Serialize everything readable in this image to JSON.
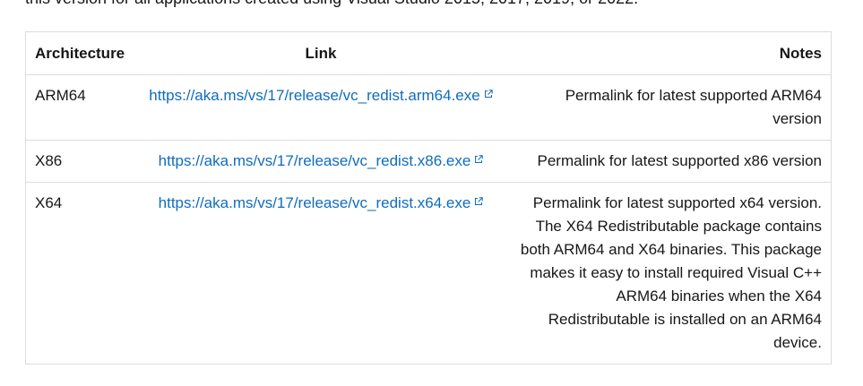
{
  "intro_text": "this version for all applications created using Visual Studio 2015, 2017, 2019, or 2022.",
  "table": {
    "headers": {
      "architecture": "Architecture",
      "link": "Link",
      "notes": "Notes"
    },
    "rows": [
      {
        "architecture": "ARM64",
        "link": "https://aka.ms/vs/17/release/vc_redist.arm64.exe",
        "notes": "Permalink for latest supported ARM64 version"
      },
      {
        "architecture": "X86",
        "link": "https://aka.ms/vs/17/release/vc_redist.x86.exe",
        "notes": "Permalink for latest supported x86 version"
      },
      {
        "architecture": "X64",
        "link": "https://aka.ms/vs/17/release/vc_redist.x64.exe",
        "notes": "Permalink for latest supported x64 version. The X64 Redistributable package contains both ARM64 and X64 binaries. This package makes it easy to install required Visual C++ ARM64 binaries when the X64 Redistributable is installed on an ARM64 device."
      }
    ]
  },
  "icons": {
    "external_link": "external-link-icon"
  },
  "colors": {
    "link": "#0f6cbd",
    "border": "#dcdcdc",
    "text": "#171717"
  }
}
